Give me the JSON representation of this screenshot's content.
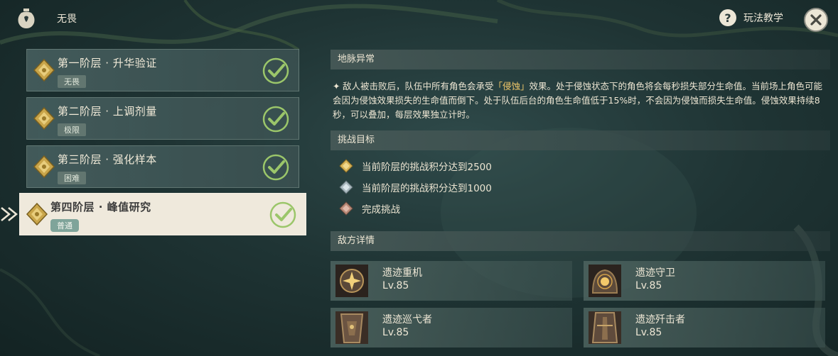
{
  "header": {
    "title": "无畏",
    "help_label": "玩法教学",
    "help_symbol": "?"
  },
  "floors": [
    {
      "name": "第一阶层 · 升华验证",
      "difficulty": "无畏",
      "completed": true,
      "active": false
    },
    {
      "name": "第二阶层 · 上调剂量",
      "difficulty": "极限",
      "completed": true,
      "active": false
    },
    {
      "name": "第三阶层 · 强化样本",
      "difficulty": "困难",
      "completed": true,
      "active": false
    },
    {
      "name": "第四阶层 · 峰值研究",
      "difficulty": "普通",
      "completed": true,
      "active": true
    }
  ],
  "ley_line": {
    "heading": "地脉异常",
    "star": "✦",
    "text_before": "敌人被击败后，队伍中所有角色会承受",
    "highlight": "「侵蚀」",
    "text_after": "效果。处于侵蚀状态下的角色将会每秒损失部分生命值。当前场上角色可能会因为侵蚀效果损失的生命值而倒下。处于队伍后台的角色生命值低于15%时，不会因为侵蚀而损失生命值。侵蚀效果持续8秒，可以叠加，每层效果独立计时。"
  },
  "challenge": {
    "heading": "挑战目标",
    "goals": [
      {
        "text": "当前阶层的挑战积分达到2500",
        "gem": "gold"
      },
      {
        "text": "当前阶层的挑战积分达到1000",
        "gem": "silver"
      },
      {
        "text": "完成挑战",
        "gem": "bronze"
      }
    ]
  },
  "enemies": {
    "heading": "敌方详情",
    "list": [
      {
        "name": "遗迹重机",
        "level": "Lv.85"
      },
      {
        "name": "遗迹守卫",
        "level": "Lv.85"
      },
      {
        "name": "遗迹巡弋者",
        "level": "Lv.85"
      },
      {
        "name": "遗迹歼击者",
        "level": "Lv.85"
      }
    ]
  },
  "colors": {
    "accent_gold": "#f1c86a",
    "check_green": "#9bc66a",
    "active_bg": "#efe9dc"
  }
}
